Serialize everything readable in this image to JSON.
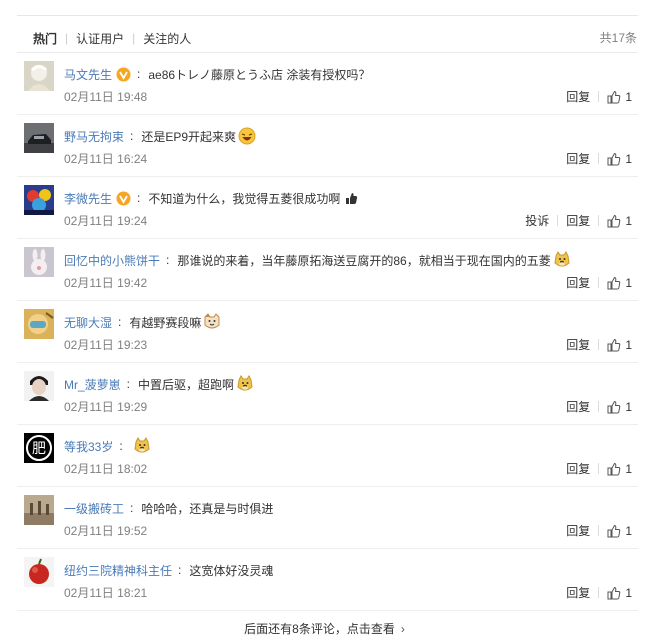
{
  "tabs": [
    "热门",
    "认证用户",
    "关注的人"
  ],
  "total": "共17条",
  "actions": {
    "report": "投诉",
    "reply": "回复"
  },
  "comments": [
    {
      "user": "马文先生",
      "verified": true,
      "text": "ae86トレノ藤原とうふ店 涂装有授权吗？",
      "emoji": "",
      "time": "02月11日 19:48",
      "likes": "1",
      "report": false,
      "avatar": "white-haired-figure-avatar"
    },
    {
      "user": "野马无拘束",
      "verified": false,
      "text": "还是EP9开起来爽",
      "emoji": "laughing-face-icon",
      "time": "02月11日 16:24",
      "likes": "1",
      "report": false,
      "avatar": "car-photo-avatar"
    },
    {
      "user": "李微先生",
      "verified": true,
      "text": "不知道为什么，我觉得五菱很成功啊",
      "emoji": "thumb-up-small-icon",
      "time": "02月11日 19:24",
      "likes": "1",
      "report": true,
      "avatar": "anime-group-avatar"
    },
    {
      "user": "回忆中的小熊饼干",
      "verified": false,
      "text": "那谁说的来着，当年藤原拓海送豆腐开的86，就相当于现在国内的五菱",
      "emoji": "doge-icon",
      "time": "02月11日 19:42",
      "likes": "1",
      "report": false,
      "avatar": "white-rabbit-avatar"
    },
    {
      "user": "无聊大湿",
      "verified": false,
      "text": "有越野赛段嘛",
      "emoji": "cat-face-icon",
      "time": "02月11日 19:23",
      "likes": "1",
      "report": false,
      "avatar": "masked-cartoon-avatar"
    },
    {
      "user": "Mr_菠萝崽",
      "verified": false,
      "text": "中置后驱，超跑啊",
      "emoji": "doge-icon",
      "time": "02月11日 19:29",
      "likes": "1",
      "report": false,
      "avatar": "man-portrait-avatar"
    },
    {
      "user": "等我33岁",
      "verified": false,
      "text": "",
      "emoji": "doge-icon",
      "time": "02月11日 18:02",
      "likes": "1",
      "report": false,
      "avatar": "fei-character-avatar",
      "avatar_text": "肥"
    },
    {
      "user": "一级搬砖工",
      "verified": false,
      "text": "哈哈哈，还真是与时俱进",
      "emoji": "",
      "time": "02月11日 19:52",
      "likes": "1",
      "report": false,
      "avatar": "workers-photo-avatar"
    },
    {
      "user": "纽约三院精神科主任",
      "verified": false,
      "text": "这宽体好没灵魂",
      "emoji": "",
      "time": "02月11日 18:21",
      "likes": "1",
      "report": false,
      "avatar": "red-apple-avatar"
    }
  ],
  "more": "后面还有8条评论，点击查看",
  "colors": {
    "link": "#4a7bb7",
    "text": "#333333",
    "muted": "#808080",
    "badge": "#f5a623"
  }
}
